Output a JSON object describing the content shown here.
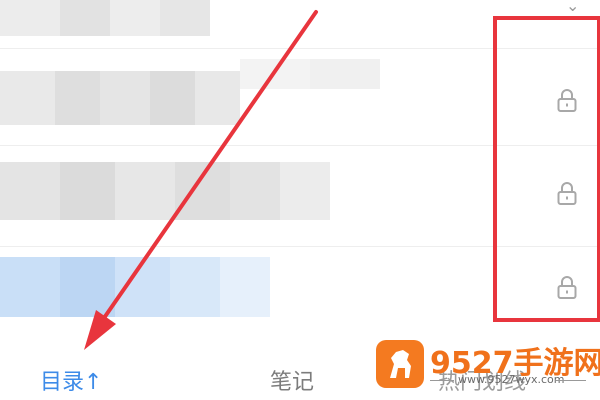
{
  "colors": {
    "accent": "#3d8be8",
    "annotation_red": "#e8353d",
    "lock": "#a8a8a8",
    "watermark_orange": "#f0711b"
  },
  "chapters": [
    {
      "title": "",
      "locked": false
    },
    {
      "title": "",
      "locked": true
    },
    {
      "title": "",
      "locked": true
    },
    {
      "title": "",
      "locked": true
    }
  ],
  "tabs": {
    "toc_label": "目录↑",
    "notes_label": "笔记",
    "hot_label": "热门划线"
  },
  "watermark": {
    "title": "9527手游网",
    "url": "www.9527wyx.com"
  },
  "icons": {
    "lock": "lock-icon",
    "logo": "horse-logo-icon"
  }
}
